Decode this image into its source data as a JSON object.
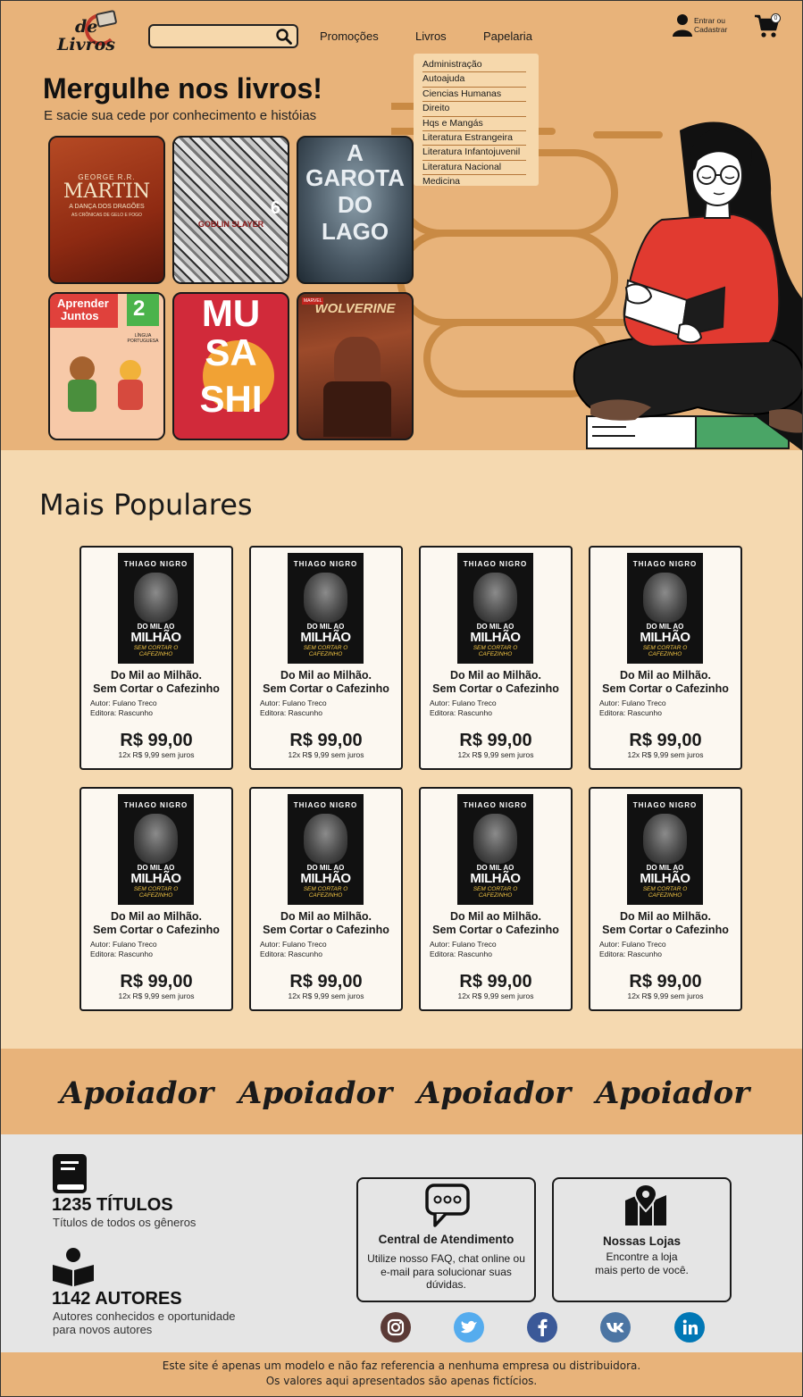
{
  "brand": {
    "logo_text_top": "de",
    "logo_text_bottom": "Livros"
  },
  "search": {
    "placeholder": ""
  },
  "nav": {
    "promocoes": "Promoções",
    "livros": "Livros",
    "papelaria": "Papelaria"
  },
  "dropdown": [
    "Administração",
    "Autoajuda",
    "Ciencias Humanas",
    "Direito",
    "Hqs e Mangás",
    "Literatura Estrangeira",
    "Literatura Infantojuvenil",
    "Literatura Nacional",
    "Medicina"
  ],
  "account": {
    "line1": "Entrar ou",
    "line2": "Cadastrar"
  },
  "cart": {
    "count": "0"
  },
  "hero": {
    "title": "Mergulhe nos livros!",
    "subtitle": "E sacie sua cede por conhecimento e históias"
  },
  "covers": [
    {
      "name": "martin",
      "line1": "GEORGE R.R.",
      "line2": "MARTIN",
      "line3": "A DANÇA DOS DRAGÕES",
      "line4": "AS CRÔNICAS DE GELO E FOGO"
    },
    {
      "name": "goblin",
      "line1": "GOBLIN SLAYER",
      "line2": "6"
    },
    {
      "name": "garota",
      "line1": "A",
      "line2": "GAROTA",
      "line3": "DO",
      "line4": "LAGO"
    },
    {
      "name": "aprender",
      "line1": "Aprender",
      "line2": "Juntos",
      "line3": "2",
      "line4": "LÍNGUA PORTUGUESA"
    },
    {
      "name": "musashi",
      "line1": "MU",
      "line2": "SA",
      "line3": "SHI"
    },
    {
      "name": "wolverine",
      "line1": "WOLVERINE",
      "line2": "MARVEL"
    }
  ],
  "popular": {
    "title": "Mais Populares",
    "products": [
      {
        "cover_author": "THIAGO NIGRO",
        "cover_title1": "DO MIL AO",
        "cover_title2": "MILHÃO",
        "cover_sub": "SEM CORTAR O CAFEZINHO",
        "title_line1": "Do Mil ao Milhão.",
        "title_line2": "Sem Cortar o Cafezinho",
        "author": "Autor: Fulano Treco",
        "publisher": "Editora: Rascunho",
        "price": "R$ 99,00",
        "installments": "12x R$ 9,99 sem juros"
      },
      {
        "cover_author": "THIAGO NIGRO",
        "cover_title1": "DO MIL AO",
        "cover_title2": "MILHÃO",
        "cover_sub": "SEM CORTAR O CAFEZINHO",
        "title_line1": "Do Mil ao Milhão.",
        "title_line2": "Sem Cortar o Cafezinho",
        "author": "Autor: Fulano Treco",
        "publisher": "Editora: Rascunho",
        "price": "R$ 99,00",
        "installments": "12x R$ 9,99 sem juros"
      },
      {
        "cover_author": "THIAGO NIGRO",
        "cover_title1": "DO MIL AO",
        "cover_title2": "MILHÃO",
        "cover_sub": "SEM CORTAR O CAFEZINHO",
        "title_line1": "Do Mil ao Milhão.",
        "title_line2": "Sem Cortar o Cafezinho",
        "author": "Autor: Fulano Treco",
        "publisher": "Editora: Rascunho",
        "price": "R$ 99,00",
        "installments": "12x R$ 9,99 sem juros"
      },
      {
        "cover_author": "THIAGO NIGRO",
        "cover_title1": "DO MIL AO",
        "cover_title2": "MILHÃO",
        "cover_sub": "SEM CORTAR O CAFEZINHO",
        "title_line1": "Do Mil ao Milhão.",
        "title_line2": "Sem Cortar o Cafezinho",
        "author": "Autor: Fulano Treco",
        "publisher": "Editora: Rascunho",
        "price": "R$ 99,00",
        "installments": "12x R$ 9,99 sem juros"
      },
      {
        "cover_author": "THIAGO NIGRO",
        "cover_title1": "DO MIL AO",
        "cover_title2": "MILHÃO",
        "cover_sub": "SEM CORTAR O CAFEZINHO",
        "title_line1": "Do Mil ao Milhão.",
        "title_line2": "Sem Cortar o Cafezinho",
        "author": "Autor: Fulano Treco",
        "publisher": "Editora: Rascunho",
        "price": "R$ 99,00",
        "installments": "12x R$ 9,99 sem juros"
      },
      {
        "cover_author": "THIAGO NIGRO",
        "cover_title1": "DO MIL AO",
        "cover_title2": "MILHÃO",
        "cover_sub": "SEM CORTAR O CAFEZINHO",
        "title_line1": "Do Mil ao Milhão.",
        "title_line2": "Sem Cortar o Cafezinho",
        "author": "Autor: Fulano Treco",
        "publisher": "Editora: Rascunho",
        "price": "R$ 99,00",
        "installments": "12x R$ 9,99 sem juros"
      },
      {
        "cover_author": "THIAGO NIGRO",
        "cover_title1": "DO MIL AO",
        "cover_title2": "MILHÃO",
        "cover_sub": "SEM CORTAR O CAFEZINHO",
        "title_line1": "Do Mil ao Milhão.",
        "title_line2": "Sem Cortar o Cafezinho",
        "author": "Autor: Fulano Treco",
        "publisher": "Editora: Rascunho",
        "price": "R$ 99,00",
        "installments": "12x R$ 9,99 sem juros"
      },
      {
        "cover_author": "THIAGO NIGRO",
        "cover_title1": "DO MIL AO",
        "cover_title2": "MILHÃO",
        "cover_sub": "SEM CORTAR O CAFEZINHO",
        "title_line1": "Do Mil ao Milhão.",
        "title_line2": "Sem Cortar o Cafezinho",
        "author": "Autor: Fulano Treco",
        "publisher": "Editora: Rascunho",
        "price": "R$ 99,00",
        "installments": "12x R$ 9,99 sem juros"
      }
    ]
  },
  "sponsors": [
    "Apoiador",
    "Apoiador",
    "Apoiador",
    "Apoiador"
  ],
  "stats": [
    {
      "icon": "book-icon",
      "number": "1235 TÍTULOS",
      "desc_line1": "Títulos de todos os gêneros",
      "desc_line2": ""
    },
    {
      "icon": "reader-icon",
      "number": "1142 AUTORES",
      "desc_line1": "Autores conhecidos e oportunidade",
      "desc_line2": "para novos autores"
    }
  ],
  "support": {
    "title": "Central de Atendimento",
    "text": "Utilize nosso FAQ, chat online ou e-mail para solucionar suas dúvidas."
  },
  "stores": {
    "title": "Nossas Lojas",
    "text_line1": "Encontre a loja",
    "text_line2": "mais perto de você."
  },
  "social": [
    {
      "name": "instagram-icon",
      "color": "#5b3a36"
    },
    {
      "name": "twitter-icon",
      "color": "#55acee"
    },
    {
      "name": "facebook-icon",
      "color": "#3b5998"
    },
    {
      "name": "vk-icon",
      "color": "#4c75a3"
    },
    {
      "name": "linkedin-icon",
      "color": "#0077b5"
    }
  ],
  "footer": {
    "line1": "Este site é apenas um modelo e não faz referencia a nenhuma empresa ou distribuidora.",
    "line2": "Os valores aqui apresentados são apenas fictícios."
  },
  "colors": {
    "primary": "#e8b37a",
    "section": "#f5d9b0",
    "info_bg": "#e5e5e5",
    "dark": "#1a1a1a"
  }
}
